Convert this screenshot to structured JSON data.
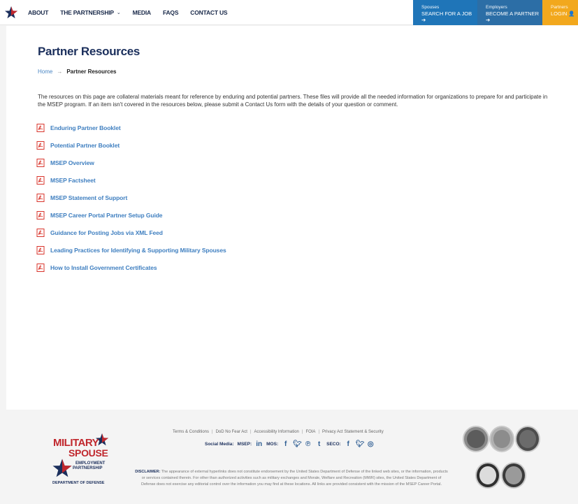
{
  "header": {
    "nav": [
      {
        "label": "ABOUT"
      },
      {
        "label": "THE PARTNERSHIP",
        "has_dropdown": true
      },
      {
        "label": "MEDIA"
      },
      {
        "label": "FAQS"
      },
      {
        "label": "CONTACT US"
      }
    ],
    "ctas": {
      "spouses": {
        "small": "Spouses",
        "big": "SEARCH FOR A JOB ➔"
      },
      "employers": {
        "small": "Employers",
        "big": "BECOME A PARTNER ➔"
      },
      "partners": {
        "small": "Partners",
        "big": "LOGIN 👤"
      }
    }
  },
  "main": {
    "title": "Partner Resources",
    "breadcrumb": {
      "home": "Home",
      "separator": "→",
      "current": "Partner Resources"
    },
    "intro": "The resources on this page are collateral materials meant for reference by enduring and potential partners. These files will provide all the needed information for organizations to prepare for and participate in the MSEP program. If an item isn't covered in the resources below, please submit a Contact Us form with the details of your question or comment.",
    "resources": [
      "Enduring Partner Booklet",
      "Potential Partner Booklet",
      "MSEP Overview",
      "MSEP Factsheet",
      "MSEP Statement of Support",
      "MSEP Career Portal Partner Setup Guide",
      "Guidance for Posting Jobs via XML Feed",
      "Leading Practices for Identifying & Supporting Military Spouses",
      "How to Install Government Certificates"
    ]
  },
  "footer": {
    "brand": {
      "line1": "MILITARY",
      "line2": "SPOUSE",
      "line3": "EMPLOYMENT",
      "line4": "PARTNERSHIP",
      "line5": "DEPARTMENT OF DEFENSE"
    },
    "links": [
      "Terms & Conditions",
      "DoD No Fear Act",
      "Accessibility Information",
      "FOIA",
      "Privacy Act Statement & Security"
    ],
    "link_separator": "|",
    "social": {
      "label": "Social Media:",
      "msep": "MSEP:",
      "mos": "MOS:",
      "seco": "SECO:"
    },
    "disclaimer_label": "DISCLAIMER:",
    "disclaimer": "The appearance of external hyperlinks does not constitute endorsement by the United States Department of Defense of the linked web sites, or the information, products or services contained therein. For other than authorized activities such as military exchanges and Morale, Welfare and Recreation (MWR) sites, the United States Department of Defense does not exercise any editorial control over the information you may find at these locations. All links are provided consistent with the mission of the MSEP Career Portal."
  },
  "colors": {
    "navy": "#1b2f5c",
    "link_blue": "#3f7fc0",
    "brand_red": "#c0272d",
    "cta_blue": "#1f75b8",
    "cta_blue2": "#2c6ea6",
    "cta_gold": "#f2a81d",
    "pdf_red": "#d9342b"
  }
}
